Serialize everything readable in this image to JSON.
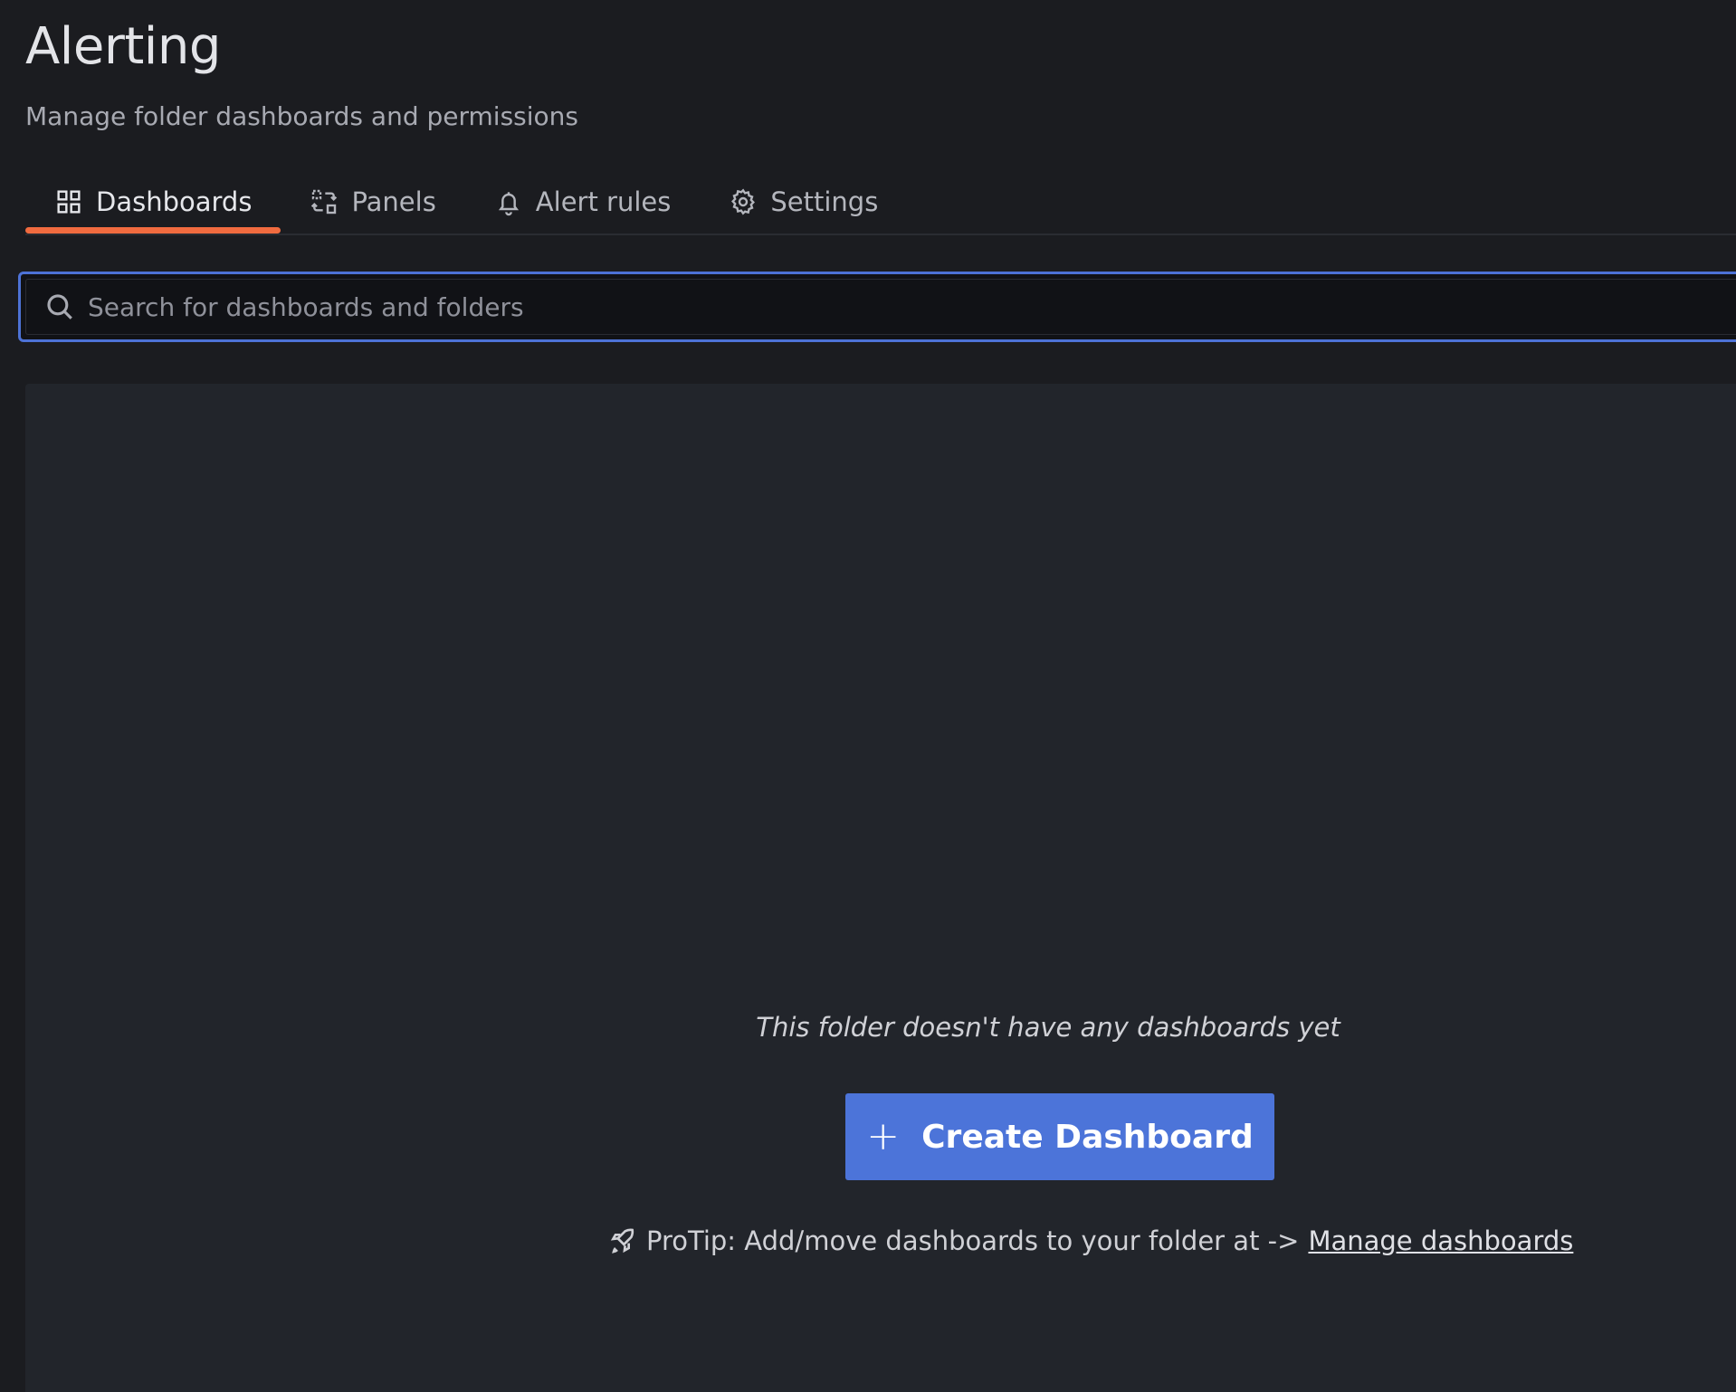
{
  "header": {
    "title": "Alerting",
    "subtitle": "Manage folder dashboards and permissions"
  },
  "tabs": [
    {
      "label": "Dashboards",
      "icon": "apps-grid-icon",
      "active": true
    },
    {
      "label": "Panels",
      "icon": "panel-library-icon",
      "active": false
    },
    {
      "label": "Alert rules",
      "icon": "bell-icon",
      "active": false
    },
    {
      "label": "Settings",
      "icon": "cog-icon",
      "active": false
    }
  ],
  "search": {
    "placeholder": "Search for dashboards and folders",
    "value": ""
  },
  "empty_state": {
    "message": "This folder doesn't have any dashboards yet",
    "create_button_label": "Create Dashboard",
    "protip_text": "ProTip: Add/move dashboards to your folder at ->",
    "protip_link": "Manage dashboards"
  },
  "colors": {
    "background": "#1b1c20",
    "panel": "#22252b",
    "active_tab_underline": "#f16b3f",
    "primary_button": "#4c74d9",
    "focus_border": "#4d72d6"
  }
}
